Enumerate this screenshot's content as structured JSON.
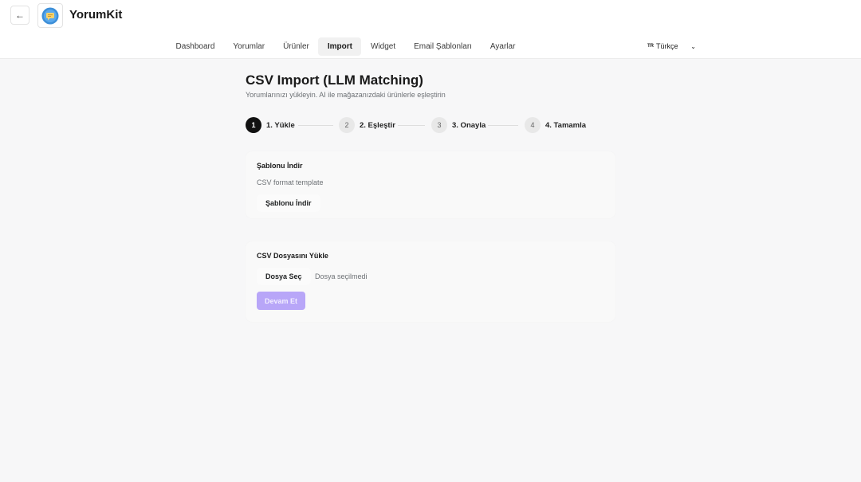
{
  "header": {
    "app_title": "YorumKit",
    "back_icon": "arrow-left-icon",
    "app_icon": "yorumkit-logo-icon"
  },
  "nav": {
    "items": [
      {
        "label": "Dashboard"
      },
      {
        "label": "Yorumlar"
      },
      {
        "label": "Ürünler"
      },
      {
        "label": "Import",
        "active": true
      },
      {
        "label": "Widget"
      },
      {
        "label": "Email Şablonları"
      },
      {
        "label": "Ayarlar"
      }
    ]
  },
  "language": {
    "flag_code": "TR",
    "selected": "Türkçe",
    "icon": "chevron-down-icon"
  },
  "page": {
    "title": "CSV Import (LLM Matching)",
    "subtitle": "Yorumlarınızı yükleyin. AI ile mağazanızdaki ürünlerle eşleştirin"
  },
  "steps": [
    {
      "number": "1",
      "label": "1. Yükle",
      "active": true
    },
    {
      "number": "2",
      "label": "2. Eşleştir"
    },
    {
      "number": "3",
      "label": "3. Onayla"
    },
    {
      "number": "4",
      "label": "4. Tamamla"
    }
  ],
  "template_card": {
    "title": "Şablonu İndir",
    "description": "CSV format template",
    "button_label": "Şablonu İndir"
  },
  "upload_card": {
    "title": "CSV Dosyasını Yükle",
    "choose_button_label": "Dosya Seç",
    "file_status": "Dosya seçilmedi",
    "continue_button_label": "Devam Et",
    "continue_disabled": true
  },
  "colors": {
    "accent_disabled": "#b8a6f8",
    "active_step": "#111111",
    "background": "#f7f7f8"
  }
}
